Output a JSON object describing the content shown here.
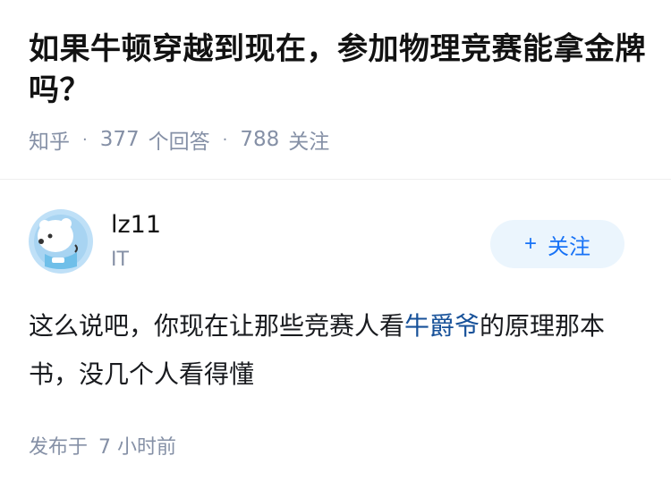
{
  "question": {
    "title": "如果牛顿穿越到现在，参加物理竞赛能拿金牌吗？",
    "source": "知乎",
    "answer_count": "377",
    "answer_label": "个回答",
    "follower_count": "788",
    "follower_label": "关注"
  },
  "answer": {
    "author": {
      "name": "lz11",
      "tag": "IT",
      "avatar_icon": "polar-bear-avatar-icon"
    },
    "follow_button": {
      "plus": "+",
      "label": "关注"
    },
    "body_before": "这么说吧，你现在让那些竞赛人看",
    "body_link": "牛爵爷",
    "body_after": "的原理那本书，没几个人看得懂",
    "time_label": "发布于",
    "time_value": "7 小时前"
  },
  "colors": {
    "meta_gray": "#8590a6",
    "link_blue": "#175199",
    "follow_blue": "#1772f6",
    "follow_bg": "#ebf5fd"
  }
}
